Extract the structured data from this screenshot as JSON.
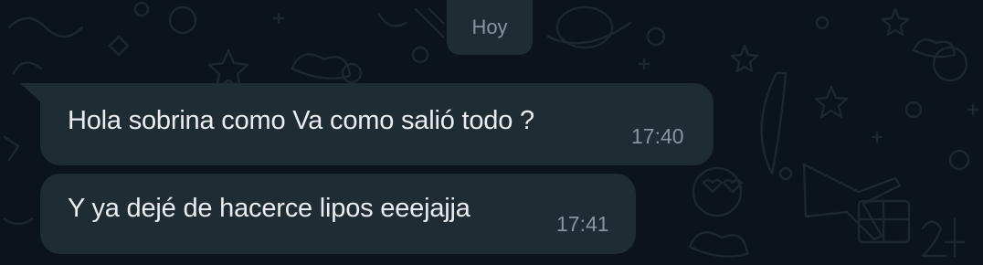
{
  "chat": {
    "date_label": "Hoy",
    "messages": [
      {
        "text": "Hola sobrina como Va como salió todo ?",
        "time": "17:40"
      },
      {
        "text": "Y ya dejé de hacerce lipos eeejajja",
        "time": "17:41"
      }
    ]
  },
  "colors": {
    "background": "#0b141a",
    "bubble_incoming": "#1f2c34",
    "text_primary": "#e9edef",
    "text_secondary": "#8696a0",
    "doodle": "#1b252c"
  },
  "icons": [
    "doodle-wallpaper-pattern"
  ]
}
